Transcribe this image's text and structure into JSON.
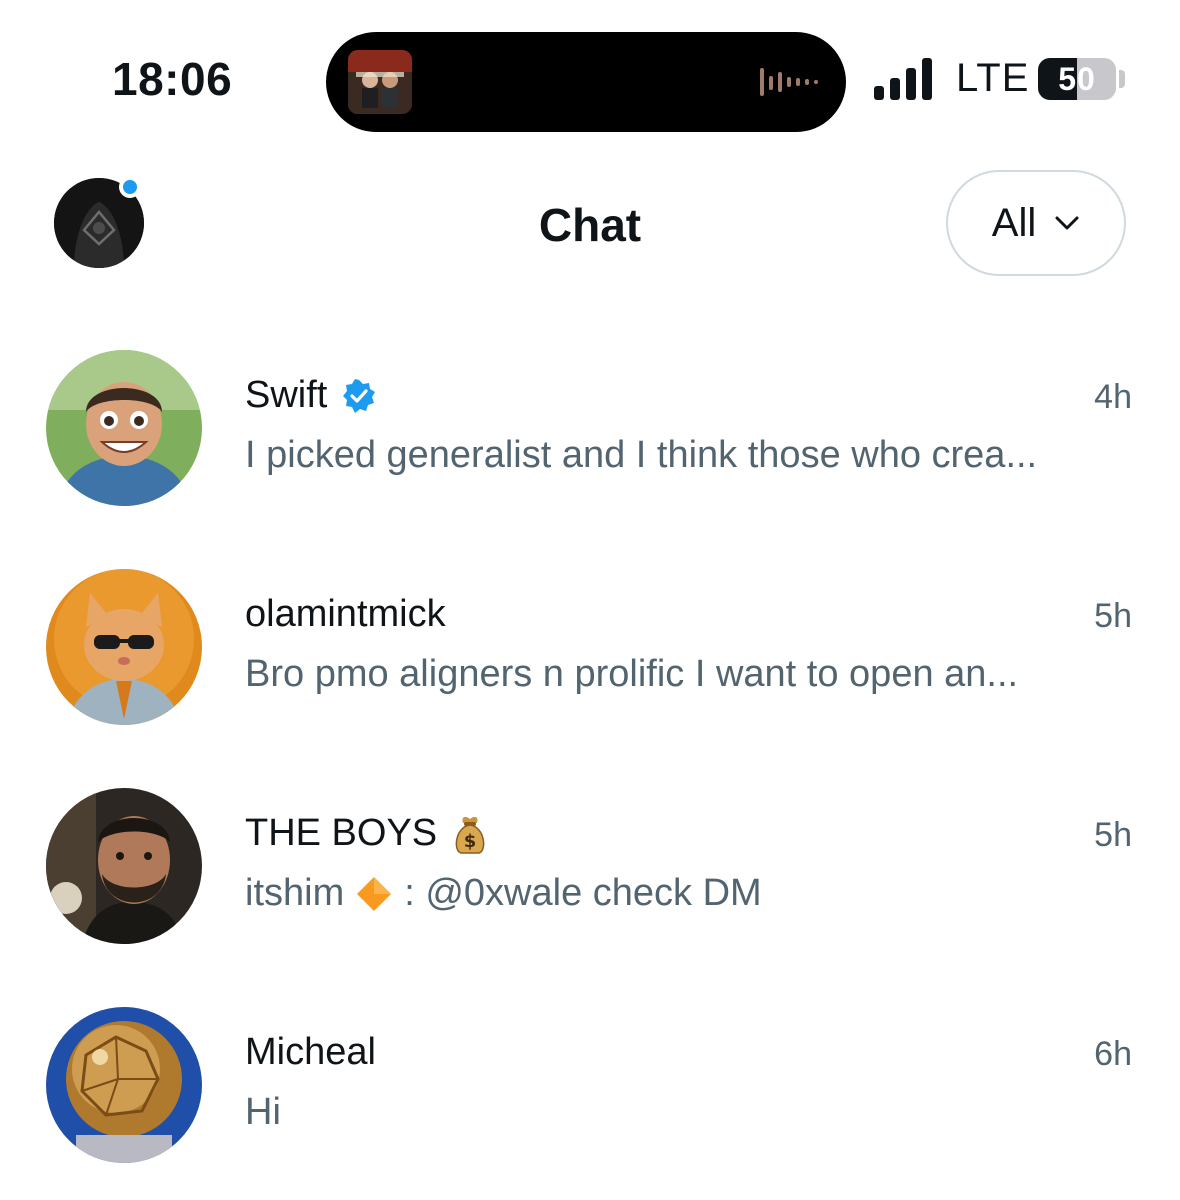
{
  "status_bar": {
    "time": "18:06",
    "network": "LTE",
    "battery_percent": "50",
    "battery_level": 0.5
  },
  "header": {
    "title": "Chat",
    "filter_label": "All",
    "has_notification": true
  },
  "chats": [
    {
      "name": "Swift",
      "verified": true,
      "time": "4h",
      "preview": "I picked generalist and I think those who crea..."
    },
    {
      "name": "olamintmick",
      "verified": false,
      "time": "5h",
      "preview": "Bro pmo aligners n prolific I want to open an..."
    },
    {
      "name": "THE BOYS",
      "name_emoji": "money-bag",
      "time": "5h",
      "preview_sender": "itshim",
      "preview_sender_emoji": "orange-diamond",
      "preview": ": @0xwale check DM"
    },
    {
      "name": "Micheal",
      "verified": false,
      "time": "6h",
      "preview": "Hi"
    }
  ],
  "colors": {
    "text_primary": "#0f1419",
    "text_secondary": "#536471",
    "accent_blue": "#1d9bf0",
    "border": "#cfd9de"
  }
}
